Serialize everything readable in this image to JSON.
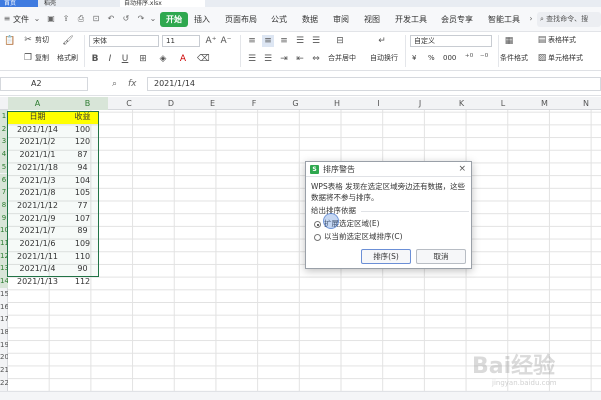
{
  "tabs": {
    "home": "首页",
    "doc1": "稻壳",
    "doc2": "自动排序.xlsx"
  },
  "menu": {
    "file": "文件",
    "start": "开始",
    "insert": "插入",
    "page_layout": "页面布局",
    "formula": "公式",
    "data": "数据",
    "review": "审阅",
    "view": "视图",
    "dev_tools": "开发工具",
    "member": "会员专享",
    "smart_tools": "智能工具",
    "search": "查找命令、搜"
  },
  "ribbon": {
    "cut": "剪切",
    "copy": "复制",
    "format_painter": "格式刷",
    "font_name": "宋体",
    "font_size": "11",
    "merge_center": "合并居中",
    "wrap_text": "自动换行",
    "number_format": "自定义",
    "table_style": "表格样式",
    "conditional_format": "条件格式",
    "cell_style": "单元格样式",
    "currency": "¥",
    "percent": "%",
    "thousands": "000"
  },
  "formula_bar": {
    "cell_ref": "A2",
    "fx": "fx",
    "value": "2021/1/14"
  },
  "columns": [
    "A",
    "B",
    "C",
    "D",
    "E",
    "F",
    "G",
    "H",
    "I",
    "J",
    "K",
    "L",
    "M",
    "N"
  ],
  "rows": [
    "1",
    "2",
    "3",
    "4",
    "5",
    "6",
    "7",
    "8",
    "9",
    "10",
    "11",
    "12",
    "13",
    "14",
    "15",
    "16",
    "17",
    "18",
    "19",
    "20",
    "21",
    "22"
  ],
  "table": {
    "headers": [
      "日期",
      "收益"
    ],
    "rows": [
      [
        "2021/1/14",
        "100"
      ],
      [
        "2021/1/2",
        "120"
      ],
      [
        "2021/1/1",
        "87"
      ],
      [
        "2021/1/18",
        "94"
      ],
      [
        "2021/1/3",
        "104"
      ],
      [
        "2021/1/8",
        "105"
      ],
      [
        "2021/1/12",
        "77"
      ],
      [
        "2021/1/9",
        "107"
      ],
      [
        "2021/1/7",
        "89"
      ],
      [
        "2021/1/6",
        "109"
      ],
      [
        "2021/1/11",
        "110"
      ],
      [
        "2021/1/4",
        "90"
      ],
      [
        "2021/1/13",
        "112"
      ]
    ]
  },
  "dialog": {
    "title": "排序警告",
    "icon_letter": "S",
    "message": "WPS表格 发现在选定区域旁边还有数据，这些数据将不参与排序。",
    "section": "给出排序依据",
    "option1": "扩展选定区域(E)",
    "option2": "以当前选定区域排序(C)",
    "sort_button": "排序(S)",
    "cancel_button": "取消",
    "close": "×"
  },
  "watermark": "Bai经验",
  "watermark_sub": "jingyan.baidu.com"
}
